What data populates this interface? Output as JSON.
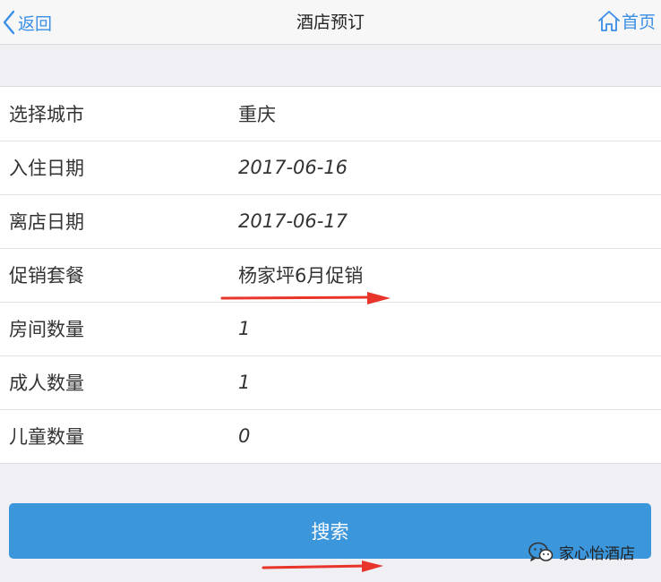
{
  "navbar": {
    "back_label": "返回",
    "title": "酒店预订",
    "home_label": "首页"
  },
  "form": {
    "rows": [
      {
        "label": "选择城市",
        "value": "重庆",
        "italic": false
      },
      {
        "label": "入住日期",
        "value": "2017-06-16",
        "italic": true
      },
      {
        "label": "离店日期",
        "value": "2017-06-17",
        "italic": true
      },
      {
        "label": "促销套餐",
        "value": "杨家坪6月促销",
        "italic": false
      },
      {
        "label": "房间数量",
        "value": "1",
        "italic": true
      },
      {
        "label": "成人数量",
        "value": "1",
        "italic": true
      },
      {
        "label": "儿童数量",
        "value": "0",
        "italic": true
      }
    ]
  },
  "search_label": "搜索",
  "watermark": "家心怡酒店",
  "icons": {
    "back": "chevron-left-icon",
    "home": "home-icon",
    "wechat": "wechat-icon"
  },
  "colors": {
    "accent": "#3a8ee6",
    "button": "#3b96dc",
    "annotation_arrow": "#e8342a"
  }
}
